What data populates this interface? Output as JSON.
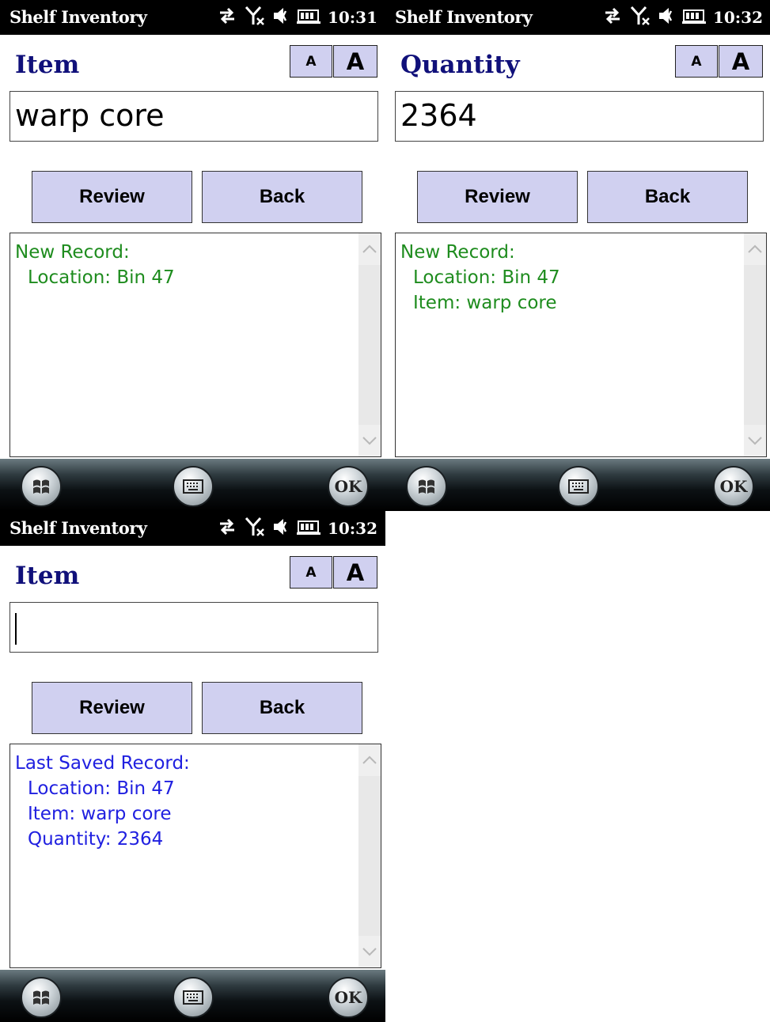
{
  "app_title": "Shelf Inventory",
  "font_buttons": {
    "small_label": "A",
    "large_label": "A"
  },
  "buttons": {
    "review": "Review",
    "back": "Back"
  },
  "taskbar": {
    "ok_label": "OK"
  },
  "icons": [
    "sync-arrows-icon",
    "no-signal-icon",
    "speaker-muted-icon",
    "battery-icon",
    "windows-start-icon",
    "keyboard-icon"
  ],
  "colors": {
    "new_record_text": "#1e8c1e",
    "saved_record_text": "#2020e0",
    "label_text": "#10107a",
    "button_fill": "#d0d0f0"
  },
  "screens": [
    {
      "clock": "10:31",
      "field_label": "Item",
      "input_value": "warp core",
      "log": {
        "header": "New Record:",
        "lines": [
          "Location: Bin 47",
          "",
          ""
        ],
        "color": "#1e8c1e"
      }
    },
    {
      "clock": "10:32",
      "field_label": "Quantity",
      "input_value": "2364",
      "log": {
        "header": "New Record:",
        "lines": [
          "Location: Bin 47",
          "Item: warp core",
          ""
        ],
        "color": "#1e8c1e"
      }
    },
    {
      "clock": "10:32",
      "field_label": "Item",
      "input_value": "",
      "log": {
        "header": "Last Saved Record:",
        "lines": [
          "Location: Bin 47",
          "Item: warp core",
          "Quantity: 2364"
        ],
        "color": "#2020e0"
      }
    }
  ]
}
